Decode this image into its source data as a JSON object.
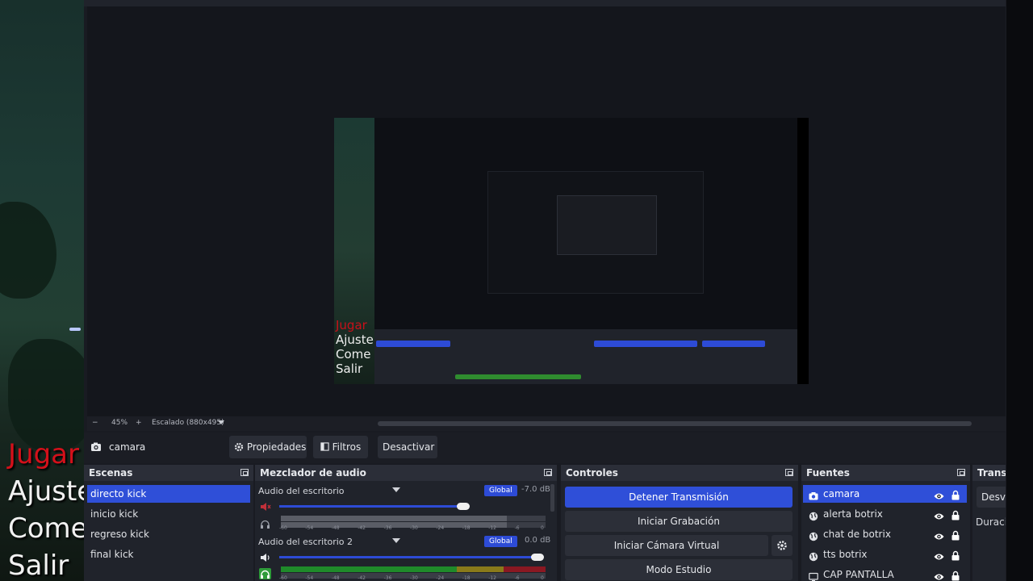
{
  "overlay_words": [
    "Jugar",
    "Ajustes",
    "Comer",
    "Salir"
  ],
  "preview": {
    "overlay_words": [
      "Jugar",
      "Ajuste",
      "Come",
      "Salir"
    ]
  },
  "zoombar": {
    "minus": "−",
    "zoom": "45%",
    "plus": "+",
    "scaling": "Escalado (880x495)"
  },
  "source_toolbar": {
    "source_name": "camara",
    "properties": "Propiedades",
    "filters": "Filtros",
    "deactivate": "Desactivar"
  },
  "scenes": {
    "title": "Escenas",
    "items": [
      "directo kick",
      "inicio kick",
      "regreso kick",
      "final kick"
    ],
    "selected_index": 0
  },
  "mixer": {
    "title": "Mezclador de audio",
    "channels": [
      {
        "name": "Audio del escritorio",
        "global": "Global",
        "db": "-7.0 dB",
        "muted": true,
        "level": 0.72
      },
      {
        "name": "Audio del escritorio 2",
        "global": "Global",
        "db": "0.0 dB",
        "muted": false,
        "level": 1.0
      }
    ],
    "ticks": [
      "-60",
      "-54",
      "-48",
      "-42",
      "-36",
      "-30",
      "-24",
      "-18",
      "-12",
      "-6",
      "0"
    ]
  },
  "controls": {
    "title": "Controles",
    "buttons": [
      "Detener Transmisión",
      "Iniciar Grabación",
      "Iniciar Cámara Virtual",
      "Modo Estudio"
    ],
    "accent": "#2f4fd8"
  },
  "sources": {
    "title": "Fuentes",
    "items": [
      {
        "name": "camara",
        "icon": "camera-icon"
      },
      {
        "name": "alerta botrix",
        "icon": "globe-icon"
      },
      {
        "name": "chat de botrix",
        "icon": "globe-icon"
      },
      {
        "name": "tts botrix",
        "icon": "globe-icon"
      },
      {
        "name": "CAP PANTALLA",
        "icon": "monitor-icon"
      }
    ]
  },
  "transitions": {
    "title": "Transic",
    "button": "Desva",
    "duration": "Duració"
  }
}
